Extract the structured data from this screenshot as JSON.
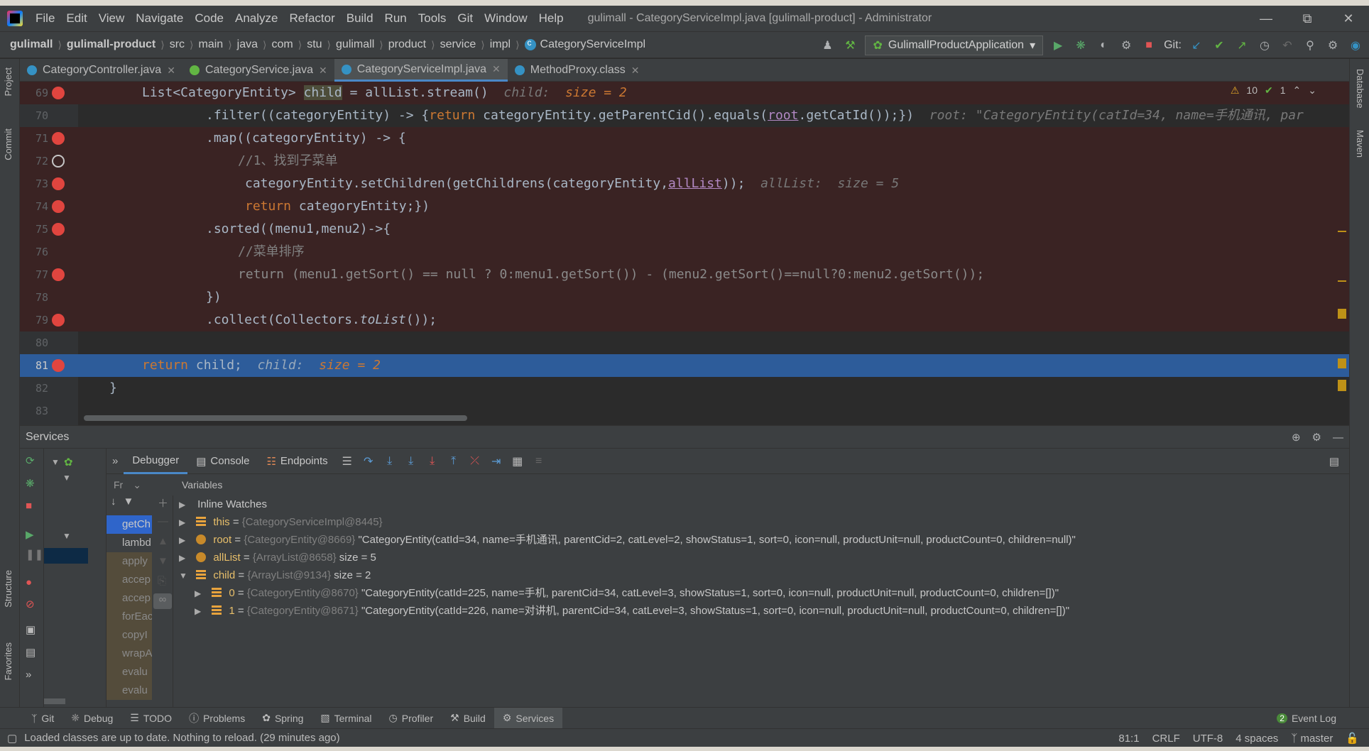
{
  "menu": [
    "File",
    "Edit",
    "View",
    "Navigate",
    "Code",
    "Analyze",
    "Refactor",
    "Build",
    "Run",
    "Tools",
    "Git",
    "Window",
    "Help"
  ],
  "window_title": "gulimall - CategoryServiceImpl.java [gulimall-product] - Administrator",
  "breadcrumb": [
    "gulimall",
    "gulimall-product",
    "src",
    "main",
    "java",
    "com",
    "stu",
    "gulimall",
    "product",
    "service",
    "impl",
    "CategoryServiceImpl"
  ],
  "run_config": "GulimallProductApplication",
  "git_label": "Git:",
  "tabs": [
    {
      "label": "CategoryController.java",
      "icon": "class-icon"
    },
    {
      "label": "CategoryService.java",
      "icon": "interface-icon"
    },
    {
      "label": "CategoryServiceImpl.java",
      "icon": "class-icon"
    },
    {
      "label": "MethodProxy.class",
      "icon": "class-icon"
    }
  ],
  "inspection": {
    "warnings": "10",
    "ok": "1"
  },
  "code_lines": [
    {
      "num": "69"
    },
    {
      "num": "70"
    },
    {
      "num": "71"
    },
    {
      "num": "72"
    },
    {
      "num": "73"
    },
    {
      "num": "74"
    },
    {
      "num": "75"
    },
    {
      "num": "76"
    },
    {
      "num": "77"
    },
    {
      "num": "78"
    },
    {
      "num": "79"
    },
    {
      "num": "80"
    },
    {
      "num": "81"
    },
    {
      "num": "82"
    },
    {
      "num": "83"
    }
  ],
  "code": {
    "l69_a": "List<CategoryEntity> ",
    "l69_b": "child",
    "l69_c": " = allList.stream()",
    "l69_hint": "child:",
    "l69_val": "size = 2",
    "l70_a": ".filter((categoryEntity) -> {",
    "l70_kw": "return",
    "l70_b": " categoryEntity.getParentCid().equals(",
    "l70_root": "root",
    "l70_c": ".getCatId());})",
    "l70_hint": "root: \"CategoryEntity(catId=34, name=手机通讯, par",
    "l71": ".map((categoryEntity) -> {",
    "l72": "//1、找到子菜单",
    "l73_a": "categoryEntity.setChildren(getChildrens(categoryEntity,",
    "l73_b": "allList",
    "l73_c": "));",
    "l73_hint": "allList:",
    "l73_val": "size = 5",
    "l74_kw": "return",
    "l74_b": " categoryEntity;})",
    "l75": ".sorted((menu1,menu2)->{",
    "l76": "//菜单排序",
    "l77": "return (menu1.getSort() == null ? 0:menu1.getSort()) - (menu2.getSort()==null?0:menu2.getSort());",
    "l78": "})",
    "l79_a": ".collect(Collectors.",
    "l79_b": "toList",
    "l79_c": "());",
    "l81_kw": "return",
    "l81_b": " child;",
    "l81_hint": "child:",
    "l81_val": "size = 2",
    "l82": "}"
  },
  "services": {
    "title": "Services",
    "debug_tabs": [
      "Debugger",
      "Console",
      "Endpoints"
    ],
    "frames_label": "Fr",
    "variables_label": "Variables",
    "frames": [
      "getCh",
      "lambd",
      "apply",
      "accep",
      "accep",
      "forEac",
      "copyI",
      "wrapA",
      "evalu",
      "evalu"
    ]
  },
  "variables": [
    {
      "name": "Inline Watches",
      "type": "",
      "value": "",
      "icon": "none",
      "indent": 0,
      "arrow": "▶"
    },
    {
      "name": "this",
      "type": "{CategoryServiceImpl@8445}",
      "value": "",
      "icon": "field",
      "indent": 0,
      "arrow": "▶"
    },
    {
      "name": "root",
      "type": "{CategoryEntity@8669}",
      "value": "\"CategoryEntity(catId=34, name=手机通讯, parentCid=2, catLevel=2, showStatus=1, sort=0, icon=null, productUnit=null, productCount=0, children=null)\"",
      "icon": "param",
      "indent": 0,
      "arrow": "▶"
    },
    {
      "name": "allList",
      "type": "{ArrayList@8658}",
      "value": "size = 5",
      "icon": "param",
      "indent": 0,
      "arrow": "▶"
    },
    {
      "name": "child",
      "type": "{ArrayList@9134}",
      "value": "size = 2",
      "icon": "field",
      "indent": 0,
      "arrow": "▼"
    },
    {
      "name": "0",
      "type": "{CategoryEntity@8670}",
      "value": "\"CategoryEntity(catId=225, name=手机, parentCid=34, catLevel=3, showStatus=1, sort=0, icon=null, productUnit=null, productCount=0, children=[])\"",
      "icon": "field",
      "indent": 1,
      "arrow": "▶"
    },
    {
      "name": "1",
      "type": "{CategoryEntity@8671}",
      "value": "\"CategoryEntity(catId=226, name=对讲机, parentCid=34, catLevel=3, showStatus=1, sort=0, icon=null, productUnit=null, productCount=0, children=[])\"",
      "icon": "field",
      "indent": 1,
      "arrow": "▶"
    }
  ],
  "bottom_tabs": [
    "Git",
    "Debug",
    "TODO",
    "Problems",
    "Spring",
    "Terminal",
    "Profiler",
    "Build",
    "Services"
  ],
  "event_log": {
    "count": "2",
    "label": "Event Log"
  },
  "status": {
    "message": "Loaded classes are up to date. Nothing to reload. (29 minutes ago)",
    "position": "81:1",
    "line_sep": "CRLF",
    "encoding": "UTF-8",
    "indent": "4 spaces",
    "branch": "master"
  },
  "side_tabs": {
    "project": "Project",
    "commit": "Commit",
    "structure": "Structure",
    "favorites": "Favorites",
    "database": "Database",
    "maven": "Maven"
  }
}
